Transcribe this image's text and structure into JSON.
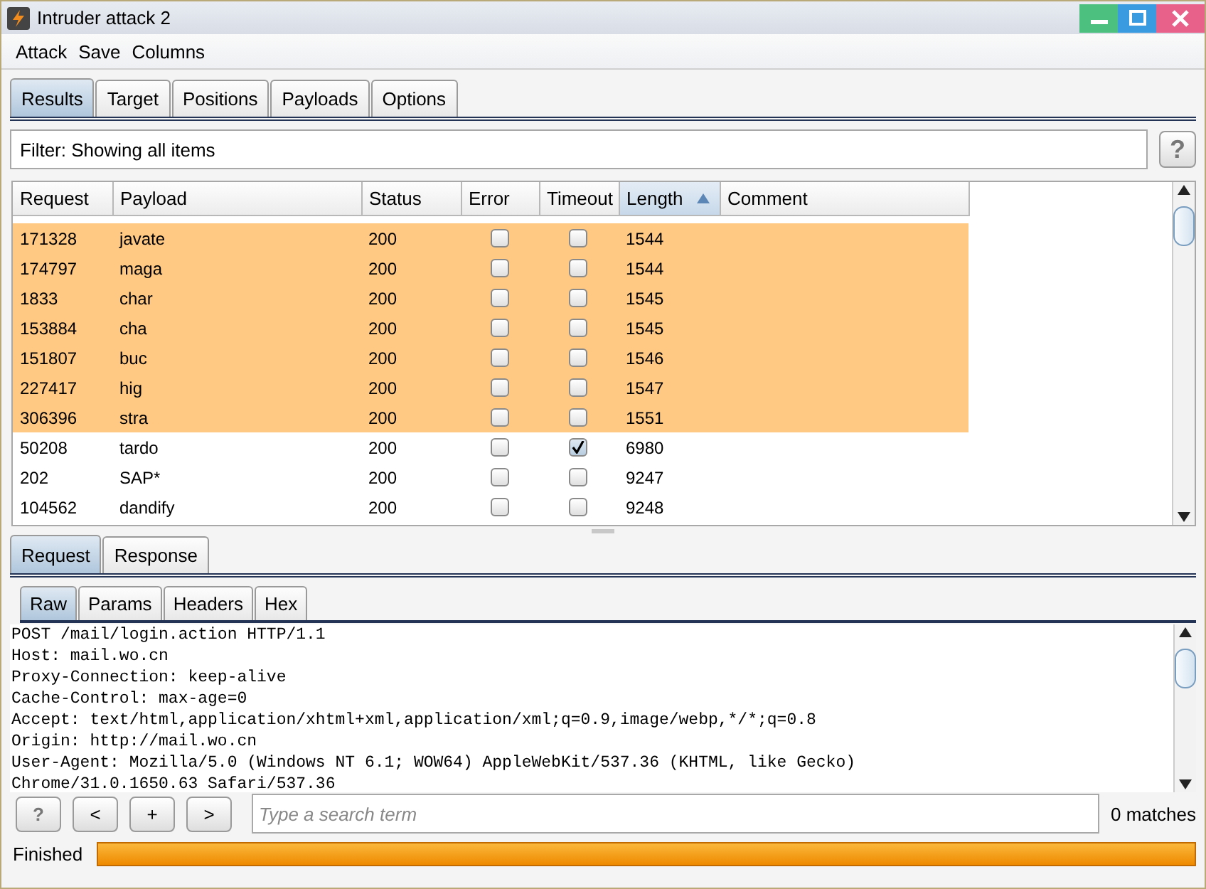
{
  "window": {
    "title": "Intruder attack 2"
  },
  "menu": [
    "Attack",
    "Save",
    "Columns"
  ],
  "tabs": [
    {
      "label": "Results",
      "selected": true
    },
    {
      "label": "Target",
      "selected": false
    },
    {
      "label": "Positions",
      "selected": false
    },
    {
      "label": "Payloads",
      "selected": false
    },
    {
      "label": "Options",
      "selected": false
    }
  ],
  "filter": {
    "text": "Filter: Showing all items"
  },
  "help_button": "?",
  "table": {
    "columns": [
      {
        "label": "Request",
        "sorted": false
      },
      {
        "label": "Payload",
        "sorted": false
      },
      {
        "label": "Status",
        "sorted": false
      },
      {
        "label": "Error",
        "sorted": false
      },
      {
        "label": "Timeout",
        "sorted": false
      },
      {
        "label": "Length",
        "sorted": true
      },
      {
        "label": "Comment",
        "sorted": false
      }
    ],
    "rows": [
      {
        "request": "171328",
        "payload": "javate",
        "status": "200",
        "error": false,
        "timeout": false,
        "length": "1544",
        "highlighted": true
      },
      {
        "request": "174797",
        "payload": "maga",
        "status": "200",
        "error": false,
        "timeout": false,
        "length": "1544",
        "highlighted": true
      },
      {
        "request": "1833",
        "payload": "char",
        "status": "200",
        "error": false,
        "timeout": false,
        "length": "1545",
        "highlighted": true
      },
      {
        "request": "153884",
        "payload": "cha",
        "status": "200",
        "error": false,
        "timeout": false,
        "length": "1545",
        "highlighted": true
      },
      {
        "request": "151807",
        "payload": "buc",
        "status": "200",
        "error": false,
        "timeout": false,
        "length": "1546",
        "highlighted": true
      },
      {
        "request": "227417",
        "payload": "hig",
        "status": "200",
        "error": false,
        "timeout": false,
        "length": "1547",
        "highlighted": true
      },
      {
        "request": "306396",
        "payload": "stra",
        "status": "200",
        "error": false,
        "timeout": false,
        "length": "1551",
        "highlighted": true
      },
      {
        "request": "50208",
        "payload": "tardo",
        "status": "200",
        "error": false,
        "timeout": true,
        "length": "6980",
        "highlighted": false
      },
      {
        "request": "202",
        "payload": "SAP*",
        "status": "200",
        "error": false,
        "timeout": false,
        "length": "9247",
        "highlighted": false
      },
      {
        "request": "104562",
        "payload": "dandify",
        "status": "200",
        "error": false,
        "timeout": false,
        "length": "9248",
        "highlighted": false
      }
    ]
  },
  "message_tabs": [
    {
      "label": "Request",
      "selected": true
    },
    {
      "label": "Response",
      "selected": false
    }
  ],
  "view_tabs": [
    {
      "label": "Raw",
      "selected": true
    },
    {
      "label": "Params",
      "selected": false
    },
    {
      "label": "Headers",
      "selected": false
    },
    {
      "label": "Hex",
      "selected": false
    }
  ],
  "message_lines": [
    "POST /mail/login.action HTTP/1.1",
    "Host: mail.wo.cn",
    "Proxy-Connection: keep-alive",
    "Cache-Control: max-age=0",
    "Accept: text/html,application/xhtml+xml,application/xml;q=0.9,image/webp,*/*;q=0.8",
    "Origin: http://mail.wo.cn",
    "User-Agent: Mozilla/5.0 (Windows NT 6.1; WOW64) AppleWebKit/537.36 (KHTML, like Gecko)",
    "Chrome/31.0.1650.63 Safari/537.36"
  ],
  "search": {
    "buttons": [
      "?",
      "<",
      "+",
      ">"
    ],
    "placeholder": "Type a search term",
    "matches": "0 matches"
  },
  "status_bar": {
    "text": "Finished",
    "level": 1
  }
}
